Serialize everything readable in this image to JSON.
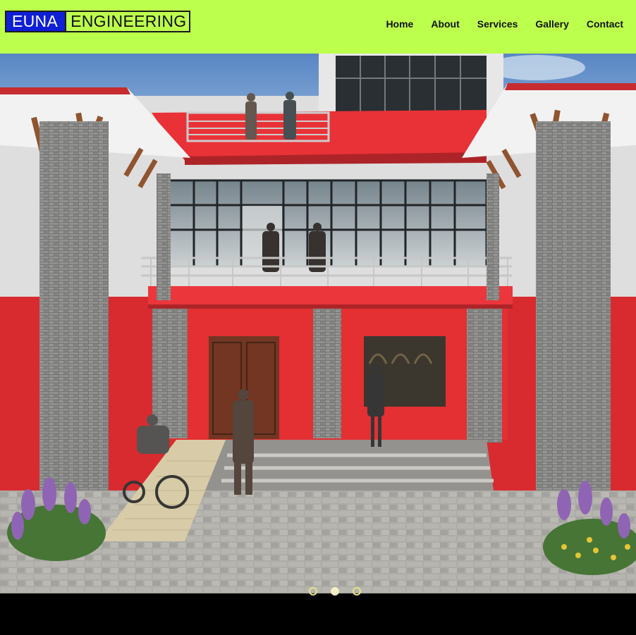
{
  "header": {
    "logo_left": "EUNA",
    "logo_right": "ENGINEERING",
    "nav": [
      "Home",
      "About",
      "Services",
      "Gallery",
      "Contact"
    ]
  },
  "hero": {
    "image_alt_icon": "building-render-image",
    "slides_total": 3,
    "active_slide": 2
  },
  "colors": {
    "header_bg": "#bdff4d",
    "logo_blue": "#0f1fd6",
    "building_red": "#e8262b",
    "footer": "#000000"
  }
}
